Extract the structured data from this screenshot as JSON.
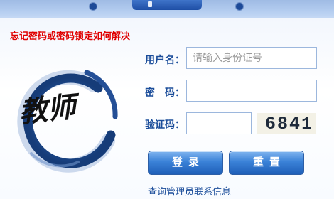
{
  "links": {
    "forgot": "忘记密码或密码锁定如何解决",
    "admin_contact": "查询管理员联系信息"
  },
  "logo": {
    "text": "教师"
  },
  "form": {
    "username_label": "用户名：",
    "username_placeholder": "请输入身份证号",
    "password_label": "密　码：",
    "captcha_label": "验证码：",
    "captcha_code": "6841"
  },
  "buttons": {
    "login": "登录",
    "reset": "重置"
  },
  "colors": {
    "accent_blue": "#1b4d9a",
    "link_red": "#e00000",
    "button_blue": "#3b82d8"
  }
}
